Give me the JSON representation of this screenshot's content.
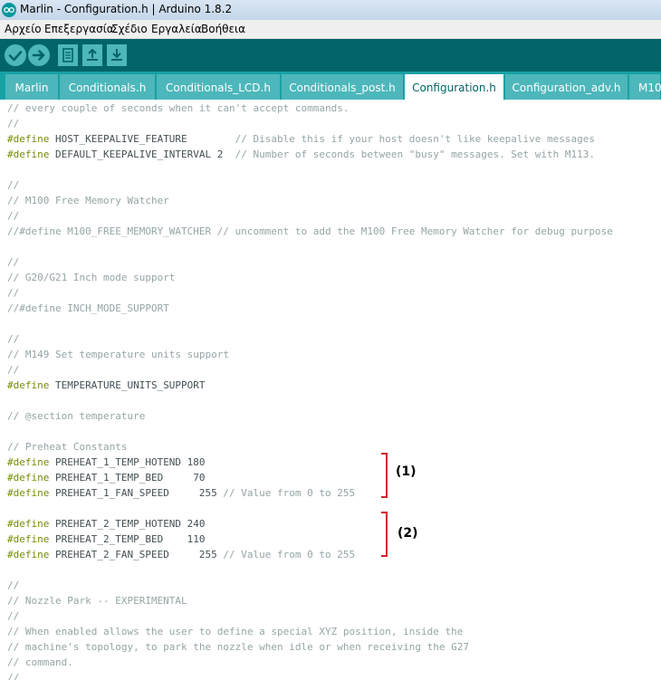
{
  "window": {
    "title": "Marlin - Configuration.h | Arduino 1.8.2"
  },
  "menu": [
    "Αρχείο",
    "Επεξεργασία",
    "Σχέδιο",
    "Εργαλεία",
    "Βοήθεια"
  ],
  "toolbar": [
    "verify-icon",
    "upload-icon",
    "new-icon",
    "open-icon",
    "save-icon"
  ],
  "tabs": [
    "Marlin",
    "Conditionals.h",
    "Conditionals_LCD.h",
    "Conditionals_post.h",
    "Configuration.h",
    "Configuration_adv.h",
    "M10"
  ],
  "active_tab": "Configuration.h",
  "code": {
    "l01": "// every couple of seconds when it can't accept commands.",
    "l02": "//",
    "l03_kw": "#define",
    "l03_tx": " HOST_KEEPALIVE_FEATURE        ",
    "l03_cm": "// Disable this if your host doesn't like keepalive messages",
    "l04_kw": "#define",
    "l04_tx": " DEFAULT_KEEPALIVE_INTERVAL 2  ",
    "l04_cm": "// Number of seconds between \"busy\" messages. Set with M113.",
    "l05": "//",
    "l06": "// M100 Free Memory Watcher",
    "l07": "//",
    "l08": "//#define M100_FREE_MEMORY_WATCHER // uncomment to add the M100 Free Memory Watcher for debug purpose",
    "l09": "//",
    "l10": "// G20/G21 Inch mode support",
    "l11": "//",
    "l12": "//#define INCH_MODE_SUPPORT",
    "l13": "//",
    "l14": "// M149 Set temperature units support",
    "l15": "//",
    "l16_kw": "#define",
    "l16_tx": " TEMPERATURE_UNITS_SUPPORT",
    "l17": "// @section temperature",
    "l18": "// Preheat Constants",
    "l19_kw": "#define",
    "l19_tx": " PREHEAT_1_TEMP_HOTEND 180",
    "l20_kw": "#define",
    "l20_tx": " PREHEAT_1_TEMP_BED     70",
    "l21_kw": "#define",
    "l21_tx": " PREHEAT_1_FAN_SPEED     255 ",
    "l21_cm": "// Value from 0 to 255",
    "l22_kw": "#define",
    "l22_tx": " PREHEAT_2_TEMP_HOTEND 240",
    "l23_kw": "#define",
    "l23_tx": " PREHEAT_2_TEMP_BED    110",
    "l24_kw": "#define",
    "l24_tx": " PREHEAT_2_FAN_SPEED     255 ",
    "l24_cm": "// Value from 0 to 255",
    "l25": "//",
    "l26": "// Nozzle Park -- EXPERIMENTAL",
    "l27": "//",
    "l28": "// When enabled allows the user to define a special XYZ position, inside the",
    "l29": "// machine's topology, to park the nozzle when idle or when receiving the G27",
    "l30": "// command.",
    "l31": "//"
  },
  "annotations": {
    "a1": "(1)",
    "a2": "(2)"
  }
}
